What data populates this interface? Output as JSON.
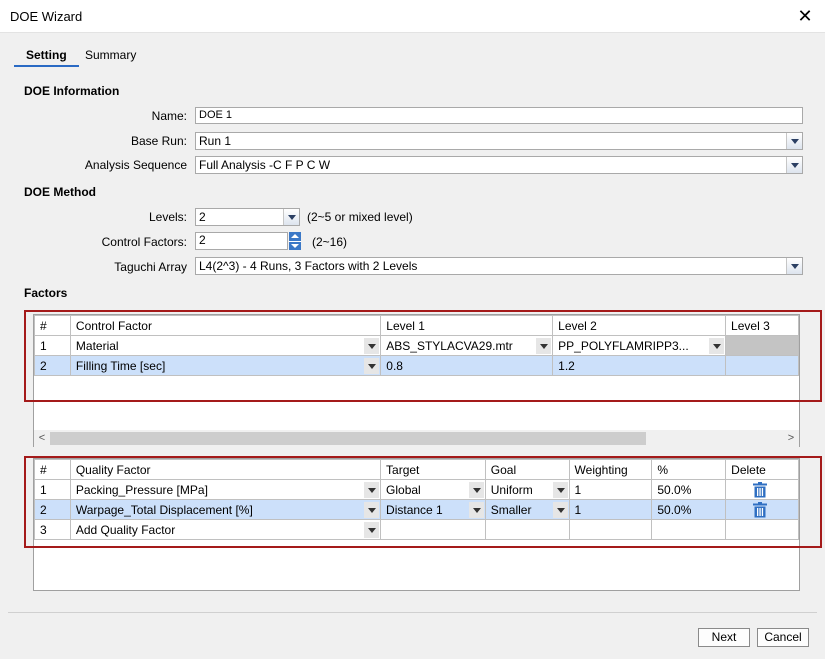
{
  "window": {
    "title": "DOE Wizard"
  },
  "tabs": [
    {
      "label": "Setting"
    },
    {
      "label": "Summary"
    }
  ],
  "doe_info": {
    "heading": "DOE Information",
    "name_label": "Name:",
    "name_value": "DOE 1",
    "base_run_label": "Base Run:",
    "base_run_value": "Run 1",
    "analysis_label": "Analysis Sequence",
    "analysis_value": "Full Analysis -C F P C W"
  },
  "doe_method": {
    "heading": "DOE Method",
    "levels_label": "Levels:",
    "levels_value": "2",
    "levels_hint": "(2~5 or mixed level)",
    "control_label": "Control Factors:",
    "control_value": "2",
    "control_hint": "(2~16)",
    "taguchi_label": "Taguchi Array",
    "taguchi_value": "L4(2^3) - 4 Runs, 3 Factors with 2 Levels"
  },
  "factors": {
    "heading": "Factors",
    "headers": [
      "#",
      "Control Factor",
      "Level 1",
      "Level 2",
      "Level 3"
    ],
    "rows": [
      {
        "num": "1",
        "factor": "Material",
        "level1": "ABS_STYLACVA29.mtr",
        "level2": "PP_POLYFLAMRIPP3...",
        "level3": ""
      },
      {
        "num": "2",
        "factor": "Filling Time [sec]",
        "level1": "0.8",
        "level2": "1.2",
        "level3": ""
      }
    ],
    "scroll_left": "<",
    "scroll_right": ">"
  },
  "quality": {
    "headers": [
      "#",
      "Quality Factor",
      "Target",
      "Goal",
      "Weighting",
      "%",
      "Delete"
    ],
    "rows": [
      {
        "num": "1",
        "factor": "Packing_Pressure [MPa]",
        "target": "Global",
        "goal": "Uniform",
        "weighting": "1",
        "percent": "50.0%"
      },
      {
        "num": "2",
        "factor": "Warpage_Total Displacement [%]",
        "target": "Distance 1",
        "goal": "Smaller",
        "weighting": "1",
        "percent": "50.0%"
      },
      {
        "num": "3",
        "factor": "Add Quality Factor",
        "target": "",
        "goal": "",
        "weighting": "",
        "percent": ""
      }
    ]
  },
  "buttons": {
    "next": "Next",
    "cancel": "Cancel"
  },
  "colors": {
    "accent": "#2a6ac4",
    "selection": "#cce0fa",
    "highlight_box": "#a41a1a"
  }
}
